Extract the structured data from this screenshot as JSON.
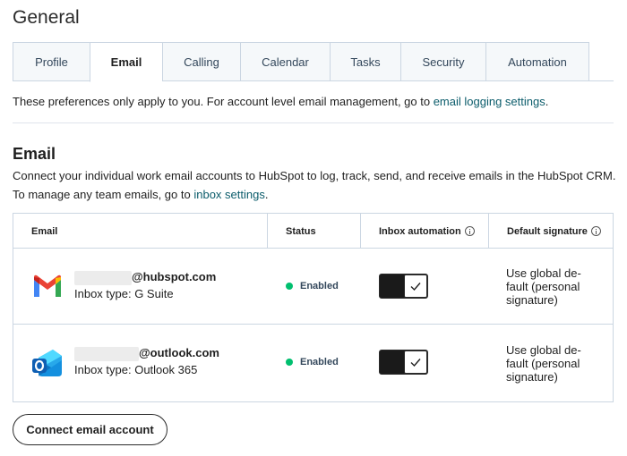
{
  "page": {
    "title": "General"
  },
  "tabs": [
    {
      "label": "Profile"
    },
    {
      "label": "Email",
      "active": true
    },
    {
      "label": "Calling"
    },
    {
      "label": "Calendar"
    },
    {
      "label": "Tasks"
    },
    {
      "label": "Security"
    },
    {
      "label": "Automation"
    }
  ],
  "intro": {
    "text": "These preferences only apply to you. For account level email management, go to ",
    "link": "email logging settings",
    "suffix": "."
  },
  "email_section": {
    "title": "Email",
    "description_line1": "Connect your individual work email accounts to HubSpot to log, track, send, and receive emails in the HubSpot CRM.",
    "description_line2_text": "To manage any team emails, go to ",
    "description_line2_link": "inbox settings",
    "description_line2_suffix": "."
  },
  "table": {
    "headers": {
      "email": "Email",
      "status": "Status",
      "inbox_automation": "Inbox automation",
      "default_signature": "Default signature"
    },
    "rows": [
      {
        "icon": "gmail-icon",
        "email_domain": "@hubspot.com",
        "inbox_type": "Inbox type: G Suite",
        "status": "Enabled",
        "status_color": "#00bf6f",
        "inbox_automation_on": true,
        "signature": "Use global de-fault (personal signature)"
      },
      {
        "icon": "outlook-icon",
        "email_domain": "@outlook.com",
        "inbox_type": "Inbox type: Outlook 365",
        "status": "Enabled",
        "status_color": "#00bf6f",
        "inbox_automation_on": true,
        "signature": "Use global de-fault (personal signature)"
      }
    ]
  },
  "actions": {
    "connect_label": "Connect email account"
  },
  "colors": {
    "link": "#0b5c6b",
    "border": "#cbd6e2",
    "toggle_on": "#1a1a1a"
  }
}
